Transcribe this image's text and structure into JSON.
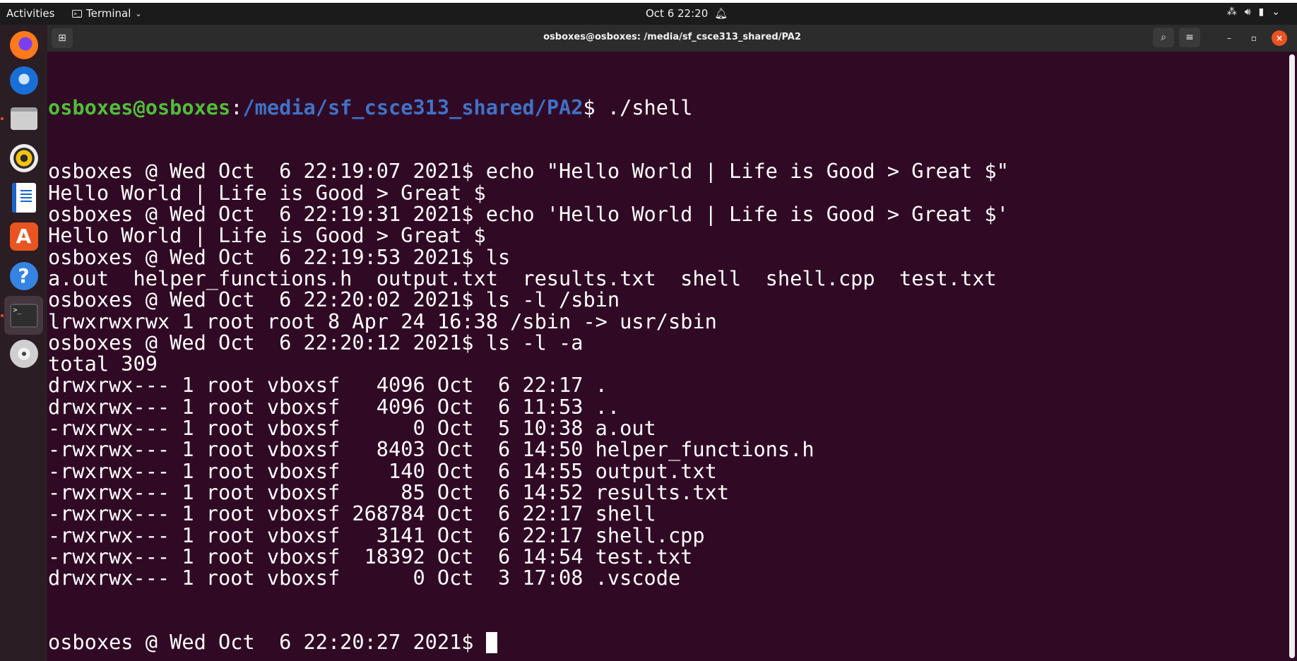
{
  "topbar": {
    "activities": "Activities",
    "app_name": "Terminal",
    "clock": "Oct 6  22:20"
  },
  "dock": {
    "items": [
      {
        "name": "firefox",
        "icon": "firefox-icon"
      },
      {
        "name": "thunderbird",
        "icon": "thunderbird-icon"
      },
      {
        "name": "files",
        "icon": "files-icon"
      },
      {
        "name": "rhythmbox",
        "icon": "rhythmbox-icon"
      },
      {
        "name": "libreoffice-writer",
        "icon": "writer-icon"
      },
      {
        "name": "ubuntu-software",
        "icon": "software-icon",
        "glyph": "A"
      },
      {
        "name": "help",
        "icon": "help-icon",
        "glyph": "?"
      },
      {
        "name": "terminal",
        "icon": "terminal-icon",
        "glyph": ">_"
      },
      {
        "name": "disc",
        "icon": "disc-icon"
      }
    ]
  },
  "window": {
    "title": "osboxes@osboxes: /media/sf_csce313_shared/PA2"
  },
  "terminal": {
    "prompt_user": "osboxes@osboxes",
    "prompt_sep": ":",
    "prompt_path": "/media/sf_csce313_shared/PA2",
    "first_command": "$ ./shell",
    "lines": [
      "osboxes @ Wed Oct  6 22:19:07 2021$ echo \"Hello World | Life is Good > Great $\"",
      "Hello World | Life is Good > Great $",
      "osboxes @ Wed Oct  6 22:19:31 2021$ echo 'Hello World | Life is Good > Great $'",
      "Hello World | Life is Good > Great $",
      "osboxes @ Wed Oct  6 22:19:53 2021$ ls",
      "a.out  helper_functions.h  output.txt  results.txt  shell  shell.cpp  test.txt",
      "osboxes @ Wed Oct  6 22:20:02 2021$ ls -l /sbin",
      "lrwxrwxrwx 1 root root 8 Apr 24 16:38 /sbin -> usr/sbin",
      "osboxes @ Wed Oct  6 22:20:12 2021$ ls -l -a",
      "total 309",
      "drwxrwx--- 1 root vboxsf   4096 Oct  6 22:17 .",
      "drwxrwx--- 1 root vboxsf   4096 Oct  6 11:53 ..",
      "-rwxrwx--- 1 root vboxsf      0 Oct  5 10:38 a.out",
      "-rwxrwx--- 1 root vboxsf   8403 Oct  6 14:50 helper_functions.h",
      "-rwxrwx--- 1 root vboxsf    140 Oct  6 14:55 output.txt",
      "-rwxrwx--- 1 root vboxsf     85 Oct  6 14:52 results.txt",
      "-rwxrwx--- 1 root vboxsf 268784 Oct  6 22:17 shell",
      "-rwxrwx--- 1 root vboxsf   3141 Oct  6 22:17 shell.cpp",
      "-rwxrwx--- 1 root vboxsf  18392 Oct  6 14:54 test.txt",
      "drwxrwx--- 1 root vboxsf      0 Oct  3 17:08 .vscode"
    ],
    "last_prompt": "osboxes @ Wed Oct  6 22:20:27 2021$ "
  },
  "colors": {
    "terminal_bg": "#300a24",
    "prompt_user": "#4fbe3a",
    "prompt_path": "#3f72c8",
    "accent": "#e95420"
  }
}
